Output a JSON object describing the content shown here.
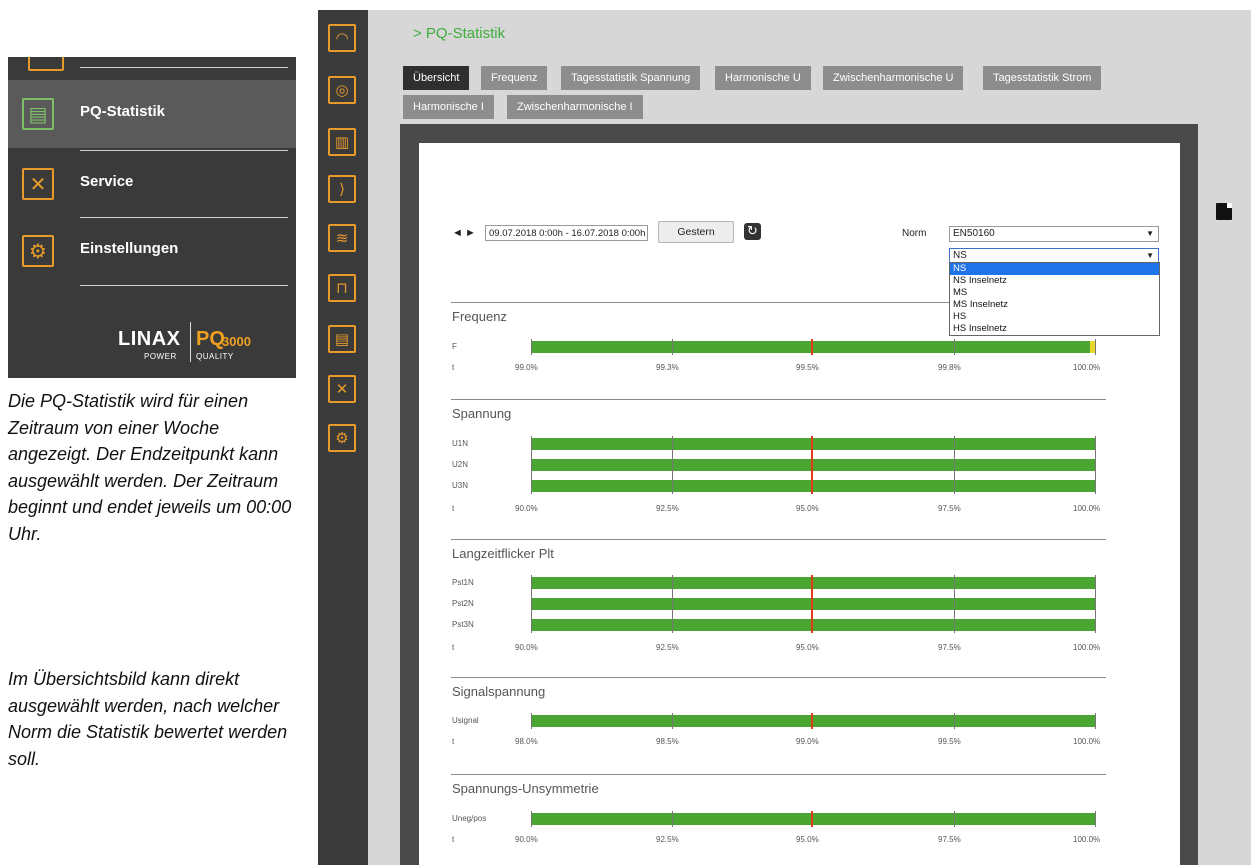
{
  "menu": {
    "items": [
      {
        "label": "PQ-Statistik",
        "icon": "document-icon",
        "active": true
      },
      {
        "label": "Service",
        "icon": "tools-icon",
        "active": false
      },
      {
        "label": "Einstellungen",
        "icon": "gear-icon",
        "active": false
      }
    ],
    "logo": {
      "name": "LINAX",
      "product": "PQ",
      "model": "3000",
      "power": "POWER",
      "quality": "QUALITY"
    }
  },
  "description": {
    "paragraph1": "Die PQ-Statistik wird für einen Zeitraum von einer Woche angezeigt. Der Endzeitpunkt kann ausgewählt werden. Der Zeitraum beginnt und endet jeweils um 00:00 Uhr.",
    "paragraph2": "Im Übersichtsbild kann direkt ausgewählt werden, nach welcher Norm die Statistik bewertet werden soll."
  },
  "iconbar": [
    "gauge-icon",
    "meter-icon",
    "bar-chart-icon",
    "vector-icon",
    "harmonics-icon",
    "waveform-icon",
    "document-icon",
    "tools-icon",
    "gear-icon"
  ],
  "page": {
    "title": "> PQ-Statistik"
  },
  "tabs_row1": [
    "Übersicht",
    "Frequenz",
    "Tagesstatistik Spannung",
    "Harmonische U",
    "Zwischenharmonische U",
    "Tagesstatistik Strom"
  ],
  "tabs_row2": [
    "Harmonische I",
    "Zwischenharmonische I"
  ],
  "controls": {
    "prev": "◄",
    "next": "►",
    "date_range": "09.07.2018 0:00h - 16.07.2018 0:00h",
    "gestern_label": "Gestern",
    "norm_label": "Norm",
    "norm_value": "EN50160",
    "level_value": "NS",
    "level_options": [
      "NS",
      "NS Inselnetz",
      "MS",
      "MS Inselnetz",
      "HS",
      "HS Inselnetz"
    ],
    "selected_level": "NS"
  },
  "sections": [
    {
      "title": "Frequenz",
      "rows": [
        "F"
      ],
      "ticks": [
        "99.0%",
        "99.3%",
        "99.5%",
        "99.8%",
        "100.0%"
      ],
      "axis": "t"
    },
    {
      "title": "Spannung",
      "rows": [
        "U1N",
        "U2N",
        "U3N"
      ],
      "ticks": [
        "90.0%",
        "92.5%",
        "95.0%",
        "97.5%",
        "100.0%"
      ],
      "axis": "t"
    },
    {
      "title": "Langzeitflicker Plt",
      "rows": [
        "Pst1N",
        "Pst2N",
        "Pst3N"
      ],
      "ticks": [
        "90.0%",
        "92.5%",
        "95.0%",
        "97.5%",
        "100.0%"
      ],
      "axis": "t"
    },
    {
      "title": "Signalspannung",
      "rows": [
        "Usignal"
      ],
      "ticks": [
        "98.0%",
        "98.5%",
        "99.0%",
        "99.5%",
        "100.0%"
      ],
      "axis": "t"
    },
    {
      "title": "Spannungs-Unsymmetrie",
      "rows": [
        "Uneg/pos"
      ],
      "ticks": [
        "90.0%",
        "92.5%",
        "95.0%",
        "97.5%",
        "100.0%"
      ],
      "axis": "t"
    }
  ],
  "colors": {
    "accent": "#e89a2a",
    "ok_green": "#4aa531",
    "limit_red": "#e03a1a",
    "title_green": "#3fae3f"
  }
}
